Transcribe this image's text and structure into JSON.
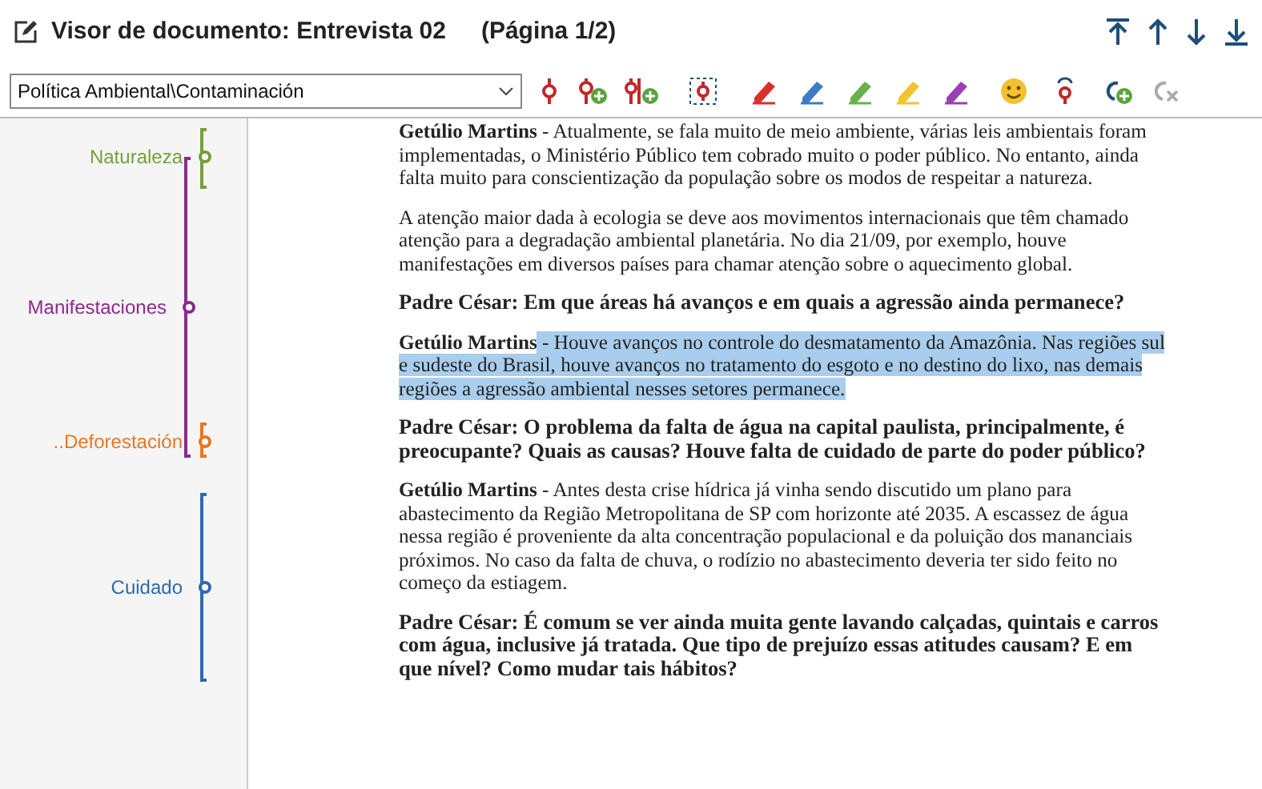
{
  "window": {
    "title": "Visor de documento: Entrevista 02",
    "page": "(Página 1/2)"
  },
  "code_selector": {
    "value": "Política Ambiental\\Contaminación"
  },
  "highlighters": [
    {
      "color": "#d9302c"
    },
    {
      "color": "#3d7bc4"
    },
    {
      "color": "#6ab04c"
    },
    {
      "color": "#f2c230"
    },
    {
      "color": "#9b3fb5"
    }
  ],
  "codes": [
    {
      "name": "Naturaleza",
      "color": "#77a03a"
    },
    {
      "name": "Manifestaciones",
      "color": "#8b2b8b"
    },
    {
      "name": "..Deforestación",
      "color": "#e87722"
    },
    {
      "name": "Cuidado",
      "color": "#2e6aad"
    }
  ],
  "paragraphs": [
    {
      "kind": "answer",
      "speaker": "Getúlio Martins",
      "text": " - Atualmente, se fala muito de meio ambiente, várias leis ambientais foram implementadas, o Ministério Público tem cobrado muito o poder público. No entanto, ainda falta muito para conscientização da população sobre os modos de respeitar a natureza.",
      "highlighted": false
    },
    {
      "kind": "plain",
      "text": "A atenção maior dada à ecologia se deve aos movimentos internacionais que têm chamado atenção para a degradação ambiental planetária. No dia 21/09, por exemplo, houve manifestações em diversos países para chamar atenção sobre o aquecimento global.",
      "highlighted": false
    },
    {
      "kind": "question",
      "text": "Padre César: Em que áreas há avanços e em quais a agressão ainda permanece?",
      "highlighted": false
    },
    {
      "kind": "answer",
      "speaker": "Getúlio Martins",
      "text": " - Houve avanços no controle do desmatamento da Amazônia. Nas regiões sul e sudeste do Brasil, houve avanços no tratamento do esgoto e no destino do lixo, nas demais regiões a agressão ambiental nesses setores permanece.",
      "highlighted": true
    },
    {
      "kind": "question",
      "text": "Padre César: O problema da falta de água na capital paulista, principalmente, é preocupante? Quais as causas? Houve falta de cuidado de parte do poder público?",
      "highlighted": false
    },
    {
      "kind": "answer",
      "speaker": "Getúlio Martins",
      "text": " - Antes desta crise hídrica já vinha sendo discutido um plano para abastecimento da Região Metropolitana de SP com horizonte até 2035. A escassez de água nessa região é proveniente da alta concentração populacional e da poluição dos mananciais próximos. No caso da falta de chuva, o rodízio no abastecimento deveria ter sido feito no começo da estiagem.",
      "highlighted": false
    },
    {
      "kind": "question",
      "text": "Padre César: É comum se ver ainda muita gente lavando calçadas, quintais e carros com água, inclusive já tratada. Que tipo de prejuízo essas atitudes causam? E em que nível? Como mudar tais hábitos?",
      "highlighted": false
    }
  ]
}
